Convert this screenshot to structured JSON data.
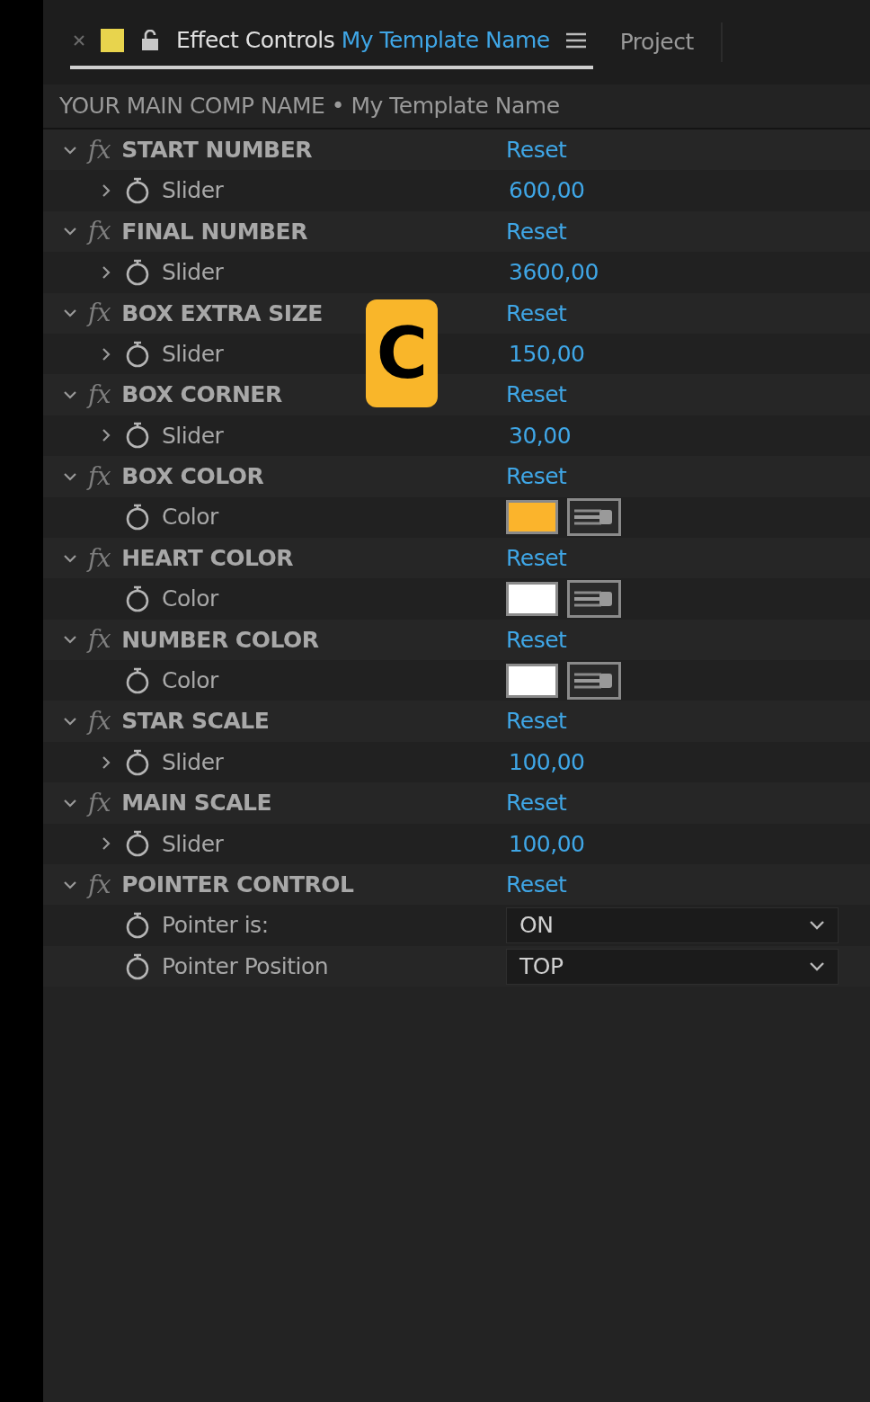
{
  "tabs": [
    {
      "kind": "effect",
      "label": "Effect Controls",
      "target": "My Template Name",
      "selected": true,
      "color": "#e8d44d",
      "locked": false
    },
    {
      "kind": "plain",
      "label": "Project",
      "selected": false
    }
  ],
  "comp_path": "YOUR MAIN COMP NAME • My Template Name",
  "badge": "C",
  "effects": [
    {
      "icon": "fx",
      "name": "START NUMBER",
      "expanded": true,
      "reset": "Reset",
      "properties": [
        {
          "kind": "slider",
          "label": "Slider",
          "value": "600,00",
          "expanded": false
        }
      ]
    },
    {
      "icon": "fx",
      "name": "FINAL NUMBER",
      "expanded": true,
      "reset": "Reset",
      "properties": [
        {
          "kind": "slider",
          "label": "Slider",
          "value": "3600,00",
          "expanded": false
        }
      ]
    },
    {
      "icon": "fx",
      "name": "BOX EXTRA SIZE",
      "expanded": true,
      "reset": "Reset",
      "properties": [
        {
          "kind": "slider",
          "label": "Slider",
          "value": "150,00",
          "expanded": false
        }
      ]
    },
    {
      "icon": "fx",
      "name": "BOX CORNER",
      "expanded": true,
      "reset": "Reset",
      "properties": [
        {
          "kind": "slider",
          "label": "Slider",
          "value": "30,00",
          "expanded": false
        }
      ]
    },
    {
      "icon": "fx",
      "name": "BOX COLOR",
      "expanded": true,
      "reset": "Reset",
      "properties": [
        {
          "kind": "color",
          "label": "Color",
          "color": "#fbb42c"
        }
      ]
    },
    {
      "icon": "fx",
      "name": "HEART COLOR",
      "expanded": true,
      "reset": "Reset",
      "properties": [
        {
          "kind": "color",
          "label": "Color",
          "color": "#ffffff"
        }
      ]
    },
    {
      "icon": "fx",
      "name": "NUMBER COLOR",
      "expanded": true,
      "reset": "Reset",
      "properties": [
        {
          "kind": "color",
          "label": "Color",
          "color": "#ffffff"
        }
      ]
    },
    {
      "icon": "fx",
      "name": "STAR SCALE",
      "expanded": true,
      "reset": "Reset",
      "properties": [
        {
          "kind": "slider",
          "label": "Slider",
          "value": "100,00",
          "expanded": false
        }
      ]
    },
    {
      "icon": "fx",
      "name": "MAIN SCALE",
      "expanded": true,
      "reset": "Reset",
      "properties": [
        {
          "kind": "slider",
          "label": "Slider",
          "value": "100,00",
          "expanded": false
        }
      ]
    },
    {
      "icon": "fx",
      "name": "POINTER CONTROL",
      "expanded": true,
      "reset": "Reset",
      "properties": [
        {
          "kind": "popup",
          "label": "Pointer is:",
          "value": "ON"
        },
        {
          "kind": "popup",
          "label": "Pointer Position",
          "value": "TOP"
        }
      ]
    }
  ]
}
